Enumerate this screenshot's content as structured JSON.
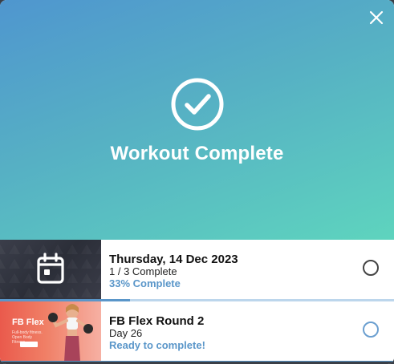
{
  "modal": {
    "title": "Workout Complete",
    "close_icon": "close-icon",
    "hero_icon": "check-circle-icon",
    "gradient": [
      "#4f96cf",
      "#5ed4be"
    ]
  },
  "items": [
    {
      "title": "Thursday, 14 Dec 2023",
      "subtitle": "1 / 3 Complete",
      "status": "33% Complete",
      "progress": 0.33,
      "thumb_icon": "calendar-icon",
      "checked": false
    },
    {
      "title": "FB Flex Round 2",
      "subtitle": "Day 26",
      "status": "Ready to complete!",
      "progress": 1.0,
      "thumb_brand": "FB Flex",
      "thumb_tagline": "Full-body fitness. Open Body Fitness",
      "checked": false
    }
  ],
  "colors": {
    "accent": "#5a96c9",
    "accent_light": "#bcd6ec"
  }
}
